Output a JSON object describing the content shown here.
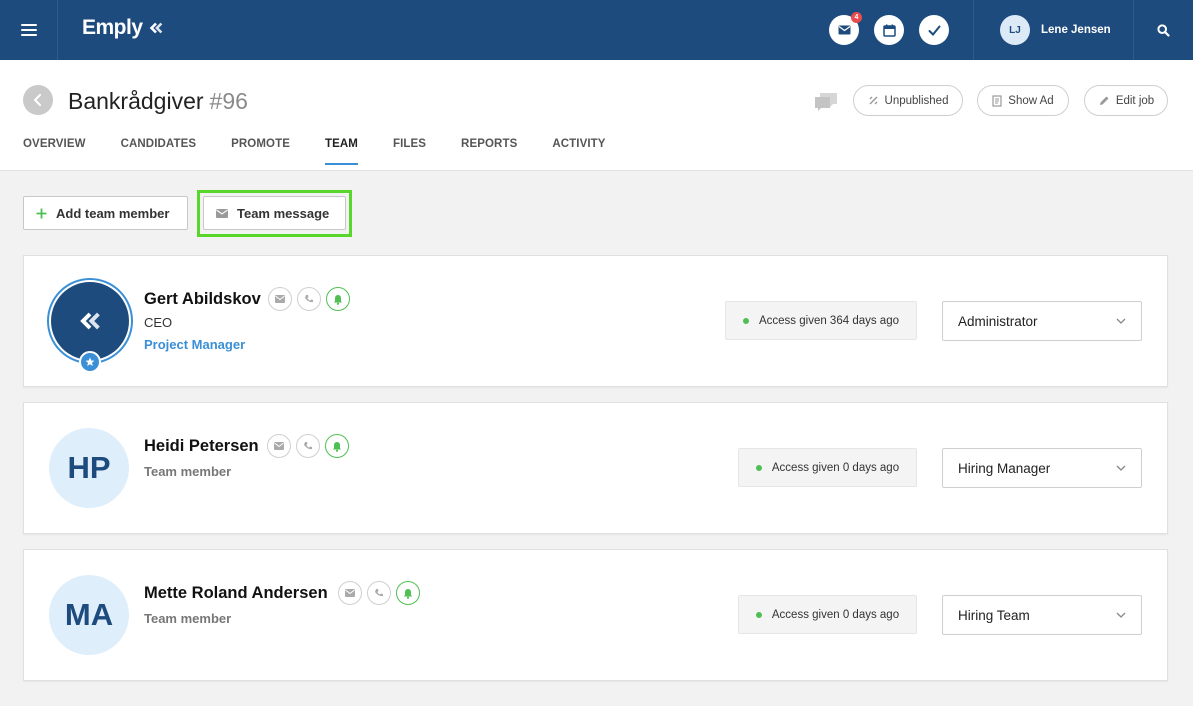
{
  "topbar": {
    "logo": "Emply",
    "mail_badge": "4",
    "user_initials": "LJ",
    "user_name": "Lene Jensen",
    "icons": [
      "menu-icon",
      "mail-icon",
      "calendar-icon",
      "check-icon",
      "search-icon"
    ],
    "bg_color": "#1e4b7e"
  },
  "header": {
    "title": "Bankrådgiver",
    "number": "#96",
    "buttons": {
      "unpublished": "Unpublished",
      "show_ad": "Show Ad",
      "edit_job": "Edit job"
    },
    "tabs": [
      "OVERVIEW",
      "CANDIDATES",
      "PROMOTE",
      "TEAM",
      "FILES",
      "REPORTS",
      "ACTIVITY"
    ],
    "active_tab": "TEAM"
  },
  "actions": {
    "add_team_member": "Add team member",
    "team_message": "Team message"
  },
  "members": [
    {
      "name": "Gert Abildskov",
      "title": "CEO",
      "link": "Project Manager",
      "access": "Access given 364 days ago",
      "role": "Administrator"
    },
    {
      "initials": "HP",
      "name": "Heidi Petersen",
      "subtitle": "Team member",
      "access": "Access given 0 days ago",
      "role": "Hiring Manager"
    },
    {
      "initials": "MA",
      "name": "Mette Roland Andersen",
      "subtitle": "Team member",
      "access": "Access given 0 days ago",
      "role": "Hiring Team"
    }
  ],
  "colors": {
    "accent": "#3a8fd6",
    "status_green": "#4fbf54",
    "highlight": "#58d62a"
  }
}
